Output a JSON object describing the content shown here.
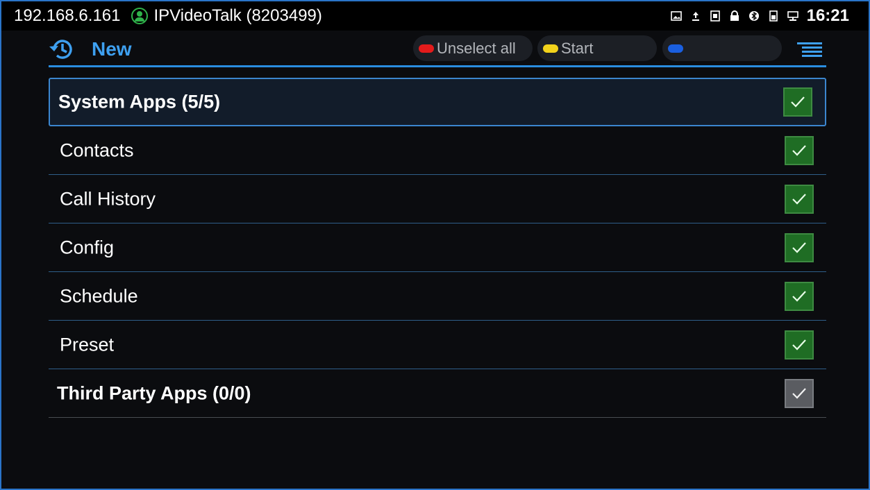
{
  "status_bar": {
    "ip": "192.168.6.161",
    "account": "IPVideoTalk (8203499)",
    "icons": [
      "image-icon",
      "upload-icon",
      "sim-card-icon",
      "lock-icon",
      "bluetooth-icon",
      "battery-icon",
      "network-icon"
    ],
    "time": "16:21"
  },
  "header": {
    "title": "New",
    "buttons": {
      "unselect_all": {
        "label": "Unselect all",
        "color": "#e41b1b"
      },
      "start": {
        "label": "Start",
        "color": "#f2d21b"
      },
      "blue": {
        "label": "",
        "color": "#1a5fe0"
      }
    }
  },
  "list": {
    "rows": [
      {
        "label": "System Apps  (5/5)",
        "checked": true
      },
      {
        "label": "Contacts",
        "checked": true
      },
      {
        "label": "Call History",
        "checked": true
      },
      {
        "label": "Config",
        "checked": true
      },
      {
        "label": "Schedule",
        "checked": true
      },
      {
        "label": "Preset",
        "checked": true
      },
      {
        "label": "Third Party Apps  (0/0)",
        "checked": true
      }
    ]
  },
  "colors": {
    "accent": "#3ea0f0",
    "check_green": "#1f6d24",
    "check_disabled": "#5a5c61"
  }
}
